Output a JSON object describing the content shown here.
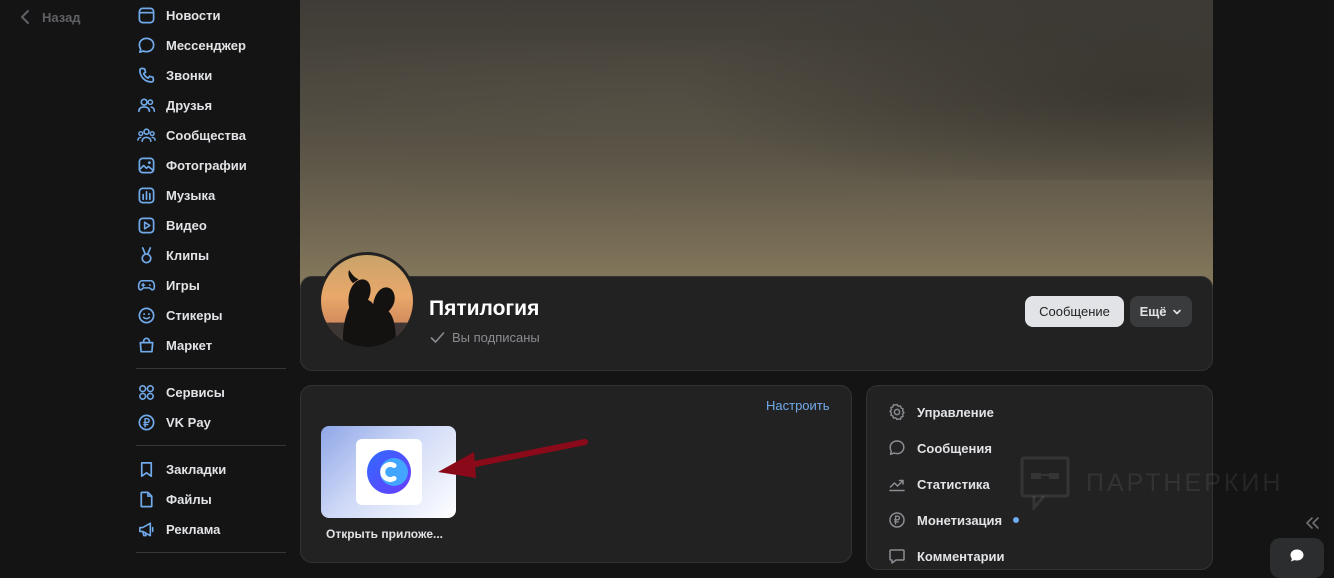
{
  "back": {
    "label": "Назад"
  },
  "sidebar": {
    "main_items": [
      {
        "label": "Новости",
        "icon": "newspaper-icon"
      },
      {
        "label": "Мессенджер",
        "icon": "message-bubble-icon"
      },
      {
        "label": "Звонки",
        "icon": "phone-icon"
      },
      {
        "label": "Друзья",
        "icon": "users-icon"
      },
      {
        "label": "Сообщества",
        "icon": "communities-icon"
      },
      {
        "label": "Фотографии",
        "icon": "photo-icon"
      },
      {
        "label": "Музыка",
        "icon": "music-icon"
      },
      {
        "label": "Видео",
        "icon": "video-icon"
      },
      {
        "label": "Клипы",
        "icon": "clips-icon"
      },
      {
        "label": "Игры",
        "icon": "gamepad-icon"
      },
      {
        "label": "Стикеры",
        "icon": "sticker-icon"
      },
      {
        "label": "Маркет",
        "icon": "shopping-bag-icon"
      }
    ],
    "service_items": [
      {
        "label": "Сервисы",
        "icon": "grid-icon"
      },
      {
        "label": "VK Pay",
        "icon": "ruble-coin-icon"
      }
    ],
    "extra_items": [
      {
        "label": "Закладки",
        "icon": "bookmark-icon"
      },
      {
        "label": "Файлы",
        "icon": "file-icon"
      },
      {
        "label": "Реклама",
        "icon": "megaphone-icon"
      }
    ]
  },
  "profile": {
    "name": "Пятилогия",
    "status": "Вы подписаны",
    "message_button": "Сообщение",
    "more_button": "Ещё"
  },
  "apps": {
    "setup_link": "Настроить",
    "app_label": "Открыть приложе..."
  },
  "manage": {
    "items": [
      {
        "label": "Управление",
        "icon": "gear-icon"
      },
      {
        "label": "Сообщения",
        "icon": "message-bubble-icon"
      },
      {
        "label": "Статистика",
        "icon": "chart-trend-icon"
      },
      {
        "label": "Монетизация",
        "icon": "ruble-coin-icon"
      },
      {
        "label": "Комментарии",
        "icon": "comment-icon"
      }
    ]
  },
  "watermark": {
    "text": "ПАРТНЕРКИН"
  },
  "colors": {
    "background": "#141414",
    "card": "#222222",
    "accent": "#71aaeb",
    "icon": "#71aaeb",
    "arrow": "#8b0a1a"
  }
}
